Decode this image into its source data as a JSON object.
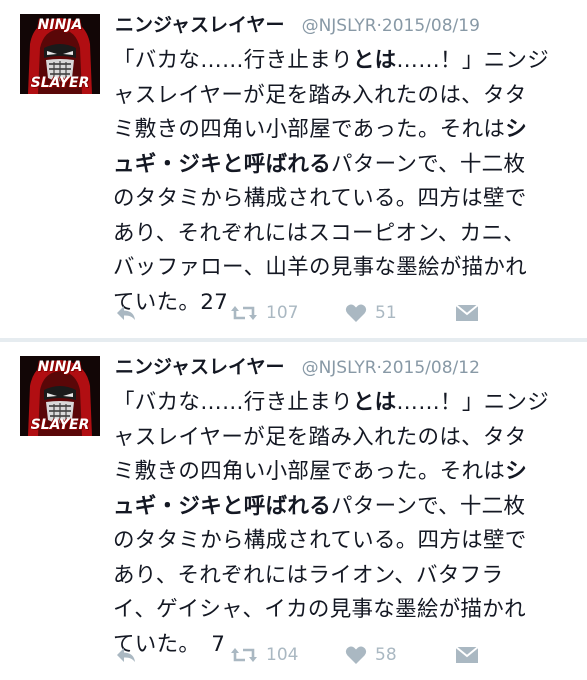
{
  "tweets": [
    {
      "avatar": {
        "label_top": "NINJA",
        "label_bottom": "SLAYER"
      },
      "name": "ニンジャスレイヤー",
      "handle": "@NJSLYR",
      "sep": "·",
      "date": "2015/08/19",
      "lines": [
        [
          "「バカな……行き止まり",
          "とは",
          "……！」ニンジ"
        ],
        [
          "ャスレイヤーが足を踏み入れたのは、タタ"
        ],
        [
          "ミ敷きの四角い小部屋であった。それは",
          "シ",
          ""
        ],
        [
          "",
          "ュギ・ジキと呼ばれる",
          "パターンで、十二枚"
        ],
        [
          "のタタミから構成されている。四方は壁で"
        ],
        [
          "あり、それぞれにはスコーピオン、カニ、"
        ],
        [
          "バッファロー、山羊の見事な墨絵が描かれ"
        ],
        [
          "ていた。27"
        ]
      ],
      "retweets": "107",
      "likes": "51"
    },
    {
      "avatar": {
        "label_top": "NINJA",
        "label_bottom": "SLAYER"
      },
      "name": "ニンジャスレイヤー",
      "handle": "@NJSLYR",
      "sep": "·",
      "date": "2015/08/12",
      "lines": [
        [
          "「バカな……行き止まり",
          "とは",
          "……！」ニンジ"
        ],
        [
          "ャスレイヤーが足を踏み入れたのは、タタ"
        ],
        [
          "ミ敷きの四角い小部屋であった。それは",
          "シ",
          ""
        ],
        [
          "",
          "ュギ・ジキと呼ばれる",
          "パターンで、十二枚"
        ],
        [
          "のタタミから構成されている。四方は壁で"
        ],
        [
          "あり、それぞれにはライオン、バタフラ"
        ],
        [
          "イ、ゲイシャ、イカの見事な墨絵が描かれ"
        ],
        [
          "ていた。　7"
        ]
      ],
      "retweets": "104",
      "likes": "58"
    }
  ]
}
